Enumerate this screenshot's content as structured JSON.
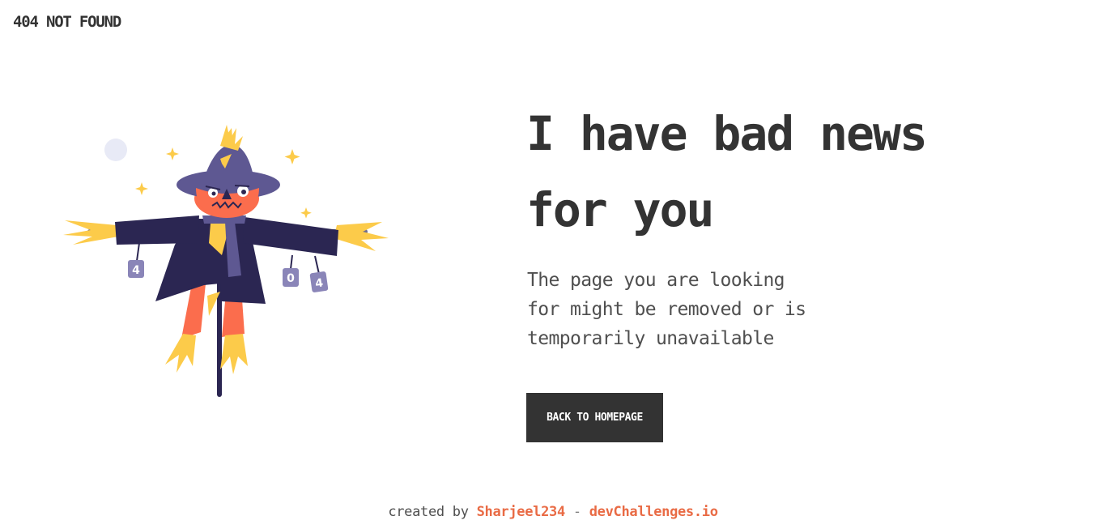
{
  "header": {
    "brand": "404 NOT FOUND"
  },
  "main": {
    "headline_line1": "I have bad news",
    "headline_line2": "for you",
    "message_line1": "The page you are looking",
    "message_line2": "for might be removed or is",
    "message_line3": "temporarily unavailable",
    "button_label": "BACK TO HOMEPAGE"
  },
  "illustration": {
    "can_labels": [
      "4",
      "0",
      "4"
    ]
  },
  "footer": {
    "created_by": "created by",
    "author": "Sharjeel234",
    "separator": "-",
    "site": "devChallenges.io"
  },
  "colors": {
    "text": "#333333",
    "accent": "#e96b45",
    "button_bg": "#333333",
    "hat": "#5e5892",
    "coat": "#2b2652",
    "face": "#fb6d4d",
    "straw": "#fccb4a"
  }
}
